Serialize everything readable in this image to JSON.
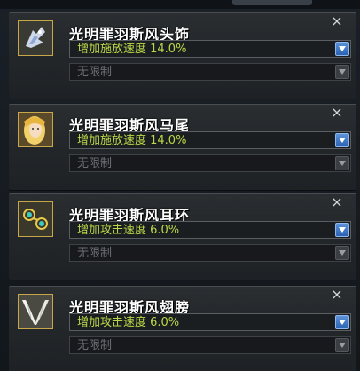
{
  "slots": [
    {
      "name": "光明罪羽斯风头饰",
      "icon": "winged-headpiece-icon",
      "option": "增加施放速度 14.0%",
      "sub_option": "无限制",
      "close": "×"
    },
    {
      "name": "光明罪羽斯风马尾",
      "icon": "blonde-ponytail-icon",
      "option": "增加施放速度 14.0%",
      "sub_option": "无限制",
      "close": "×"
    },
    {
      "name": "光明罪羽斯风耳环",
      "icon": "teal-earring-icon",
      "option": "增加攻击速度 6.0%",
      "sub_option": "无限制",
      "close": "×"
    },
    {
      "name": "光明罪羽斯风翅膀",
      "icon": "white-wings-icon",
      "option": "增加攻击速度 6.0%",
      "sub_option": "无限制",
      "close": "×"
    }
  ],
  "colors": {
    "option_text": "#b9d848",
    "dropdown_arrow_active": "#2a63b3",
    "icon_border": "#c8a64a"
  }
}
